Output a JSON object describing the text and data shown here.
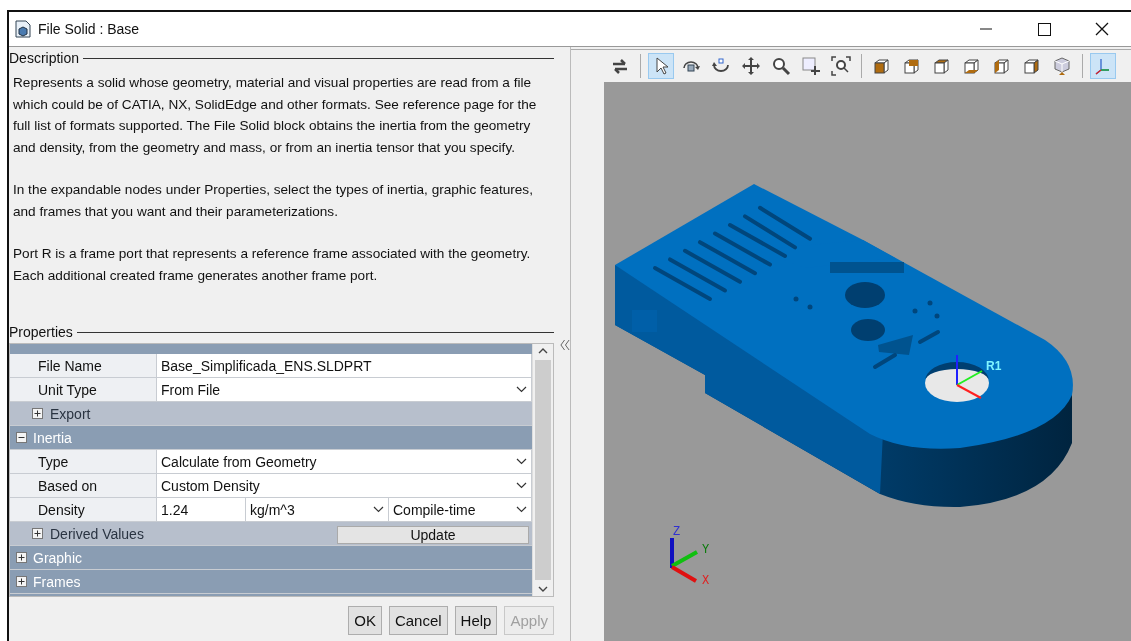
{
  "window": {
    "title": "File Solid : Base"
  },
  "description": {
    "heading": "Description",
    "paragraphs": [
      "Represents a solid whose geometry, material and visual properties are read from a file which could be of CATIA, NX, SolidEdge and other formats. See reference page for the full list of formats supported. The File Solid block obtains the inertia from the geometry and density, from the geometry and mass, or from an inertia tensor that you specify.",
      "In the expandable nodes under Properties, select the types of inertia, graphic features, and frames that you want and their parameterizations.",
      "Port R is a frame port that represents a reference frame associated with the geometry. Each additional created frame generates another frame port."
    ]
  },
  "properties": {
    "heading": "Properties",
    "rows": [
      {
        "kind": "property",
        "label": "File Name",
        "fields": [
          {
            "kind": "text",
            "value": "Base_Simplificada_ENS.SLDPRT"
          }
        ]
      },
      {
        "kind": "property",
        "label": "Unit Type",
        "fields": [
          {
            "kind": "dropdown",
            "value": "From File"
          }
        ]
      },
      {
        "kind": "subgroup",
        "label": "Export",
        "expanded": false
      },
      {
        "kind": "group",
        "label": "Inertia",
        "expanded": true
      },
      {
        "kind": "property",
        "label": "Type",
        "fields": [
          {
            "kind": "dropdown",
            "value": "Calculate from Geometry"
          }
        ]
      },
      {
        "kind": "property",
        "label": "Based on",
        "fields": [
          {
            "kind": "dropdown",
            "value": "Custom Density"
          }
        ]
      },
      {
        "kind": "property",
        "label": "Density",
        "fields": [
          {
            "kind": "text",
            "value": "1.24"
          },
          {
            "kind": "dropdown",
            "value": "kg/m^3"
          },
          {
            "kind": "dropdown",
            "value": "Compile-time"
          }
        ]
      },
      {
        "kind": "subgroup",
        "label": "Derived Values",
        "expanded": false,
        "button": "Update"
      },
      {
        "kind": "group",
        "label": "Graphic",
        "expanded": false
      },
      {
        "kind": "group",
        "label": "Frames",
        "expanded": false
      }
    ]
  },
  "buttons": [
    {
      "label": "OK",
      "disabled": false
    },
    {
      "label": "Cancel",
      "disabled": false
    },
    {
      "label": "Help",
      "disabled": false
    },
    {
      "label": "Apply",
      "disabled": true
    }
  ],
  "toolbar": [
    {
      "kind": "swap",
      "selected": false
    },
    {
      "kind": "separator"
    },
    {
      "kind": "pointer",
      "selected": true
    },
    {
      "kind": "rotate",
      "selected": false
    },
    {
      "kind": "roll",
      "selected": false
    },
    {
      "kind": "pan",
      "selected": false
    },
    {
      "kind": "zoom",
      "selected": false
    },
    {
      "kind": "zoom-box",
      "selected": false
    },
    {
      "kind": "fit",
      "selected": false
    },
    {
      "kind": "separator"
    },
    {
      "kind": "view-front",
      "selected": false
    },
    {
      "kind": "view-back",
      "selected": false
    },
    {
      "kind": "view-top",
      "selected": false
    },
    {
      "kind": "view-bottom",
      "selected": false
    },
    {
      "kind": "view-left",
      "selected": false
    },
    {
      "kind": "view-right",
      "selected": false
    },
    {
      "kind": "view-iso",
      "selected": false
    },
    {
      "kind": "separator"
    },
    {
      "kind": "axes",
      "selected": true
    }
  ],
  "viewer": {
    "frame_label": "R1",
    "axis_labels": {
      "x": "X",
      "y": "Y",
      "z": "Z"
    }
  }
}
